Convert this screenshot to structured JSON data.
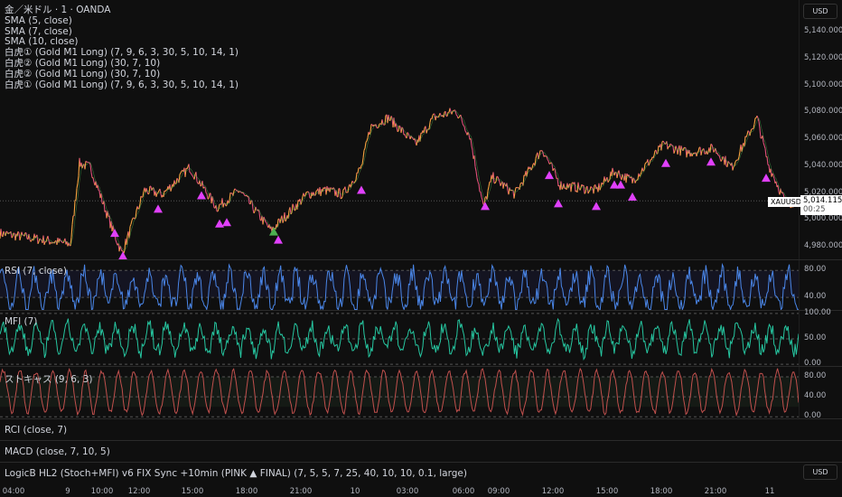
{
  "legend": {
    "title": "金／米ドル · 1 · OANDA",
    "lines": [
      "SMA (5, close)",
      "SMA (7, close)",
      "SMA (10, close)",
      "白虎① (Gold M1 Long) (7, 9, 6, 3, 30, 5, 10, 14, 1)",
      "白虎② (Gold M1 Long) (30, 7, 10)",
      "白虎② (Gold M1 Long) (30, 7, 10)",
      "白虎① (Gold M1 Long) (7, 9, 6, 3, 30, 5, 10, 14, 1)"
    ]
  },
  "currency": "USD",
  "price_axis": [
    "5,140.000",
    "5,120.000",
    "5,100.000",
    "5,080.000",
    "5,060.000",
    "5,040.000",
    "5,020.000",
    "5,000.000",
    "4,980.000"
  ],
  "price_values": [
    5140,
    5120,
    5100,
    5080,
    5060,
    5040,
    5020,
    5000,
    4980
  ],
  "symbol_flag": "XAUUSD",
  "last_price": "5,014.115",
  "countdown": "00:25",
  "colors": {
    "up": "#f7a440",
    "down": "#e0507a",
    "ma": "#4caf50",
    "marker": "#e040fb",
    "marker_alt": "#4caf50",
    "rsi": "#4a86e8",
    "mfi": "#26c6a0",
    "stoch": "#c0504d"
  },
  "price_anchors": [
    [
      0,
      4990
    ],
    [
      78,
      4982
    ],
    [
      88,
      5042
    ],
    [
      100,
      5039
    ],
    [
      125,
      4992
    ],
    [
      135,
      4975
    ],
    [
      160,
      5022
    ],
    [
      180,
      5019
    ],
    [
      210,
      5039
    ],
    [
      240,
      5009
    ],
    [
      265,
      5022
    ],
    [
      300,
      4992
    ],
    [
      340,
      5019
    ],
    [
      360,
      5022
    ],
    [
      380,
      5019
    ],
    [
      400,
      5039
    ],
    [
      410,
      5069
    ],
    [
      430,
      5076
    ],
    [
      460,
      5056
    ],
    [
      480,
      5076
    ],
    [
      505,
      5081
    ],
    [
      520,
      5063
    ],
    [
      535,
      5009
    ],
    [
      545,
      5032
    ],
    [
      570,
      5019
    ],
    [
      600,
      5053
    ],
    [
      620,
      5026
    ],
    [
      660,
      5022
    ],
    [
      680,
      5036
    ],
    [
      700,
      5029
    ],
    [
      735,
      5056
    ],
    [
      760,
      5050
    ],
    [
      790,
      5053
    ],
    [
      810,
      5039
    ],
    [
      838,
      5076
    ],
    [
      850,
      5042
    ],
    [
      870,
      5012
    ],
    [
      884,
      5014
    ]
  ],
  "markers": [
    [
      127,
      4990
    ],
    [
      136,
      4973
    ],
    [
      175,
      5008
    ],
    [
      223,
      5018
    ],
    [
      243,
      4997
    ],
    [
      251,
      4998
    ],
    [
      308,
      4985
    ],
    [
      400,
      5022
    ],
    [
      537,
      5010
    ],
    [
      608,
      5033
    ],
    [
      618,
      5012
    ],
    [
      660,
      5010
    ],
    [
      680,
      5026
    ],
    [
      687,
      5026
    ],
    [
      700,
      5017
    ],
    [
      737,
      5042
    ],
    [
      787,
      5043
    ],
    [
      848,
      5031
    ]
  ],
  "markers_alt": [
    [
      303,
      4991
    ]
  ],
  "panes": [
    {
      "label": "RSI (7, close)",
      "ticks": [
        "80.00",
        "40.00"
      ],
      "tick_values": [
        80,
        40
      ],
      "range": [
        20,
        95
      ]
    },
    {
      "label": "MFI (7)",
      "ticks": [
        "100.00",
        "50.00",
        "0.00"
      ],
      "tick_values": [
        100,
        50,
        0
      ],
      "range": [
        -5,
        105
      ]
    },
    {
      "label": "ストキャス (9, 6, 3)",
      "ticks": [
        "80.00",
        "40.00",
        "0.00"
      ],
      "tick_values": [
        80,
        40,
        0
      ],
      "range": [
        -5,
        100
      ]
    },
    {
      "label": "RCI (close, 7)"
    },
    {
      "label": "MACD (close, 7, 10, 5)"
    },
    {
      "label": "LogicB HL2 (Stoch+MFI) v6 FIX Sync +10min (PINK ▲ FINAL) (7, 5, 5, 7, 25, 40, 10, 10, 0.1, large)"
    }
  ],
  "time_axis": [
    "04:00",
    "9",
    "10:00",
    "12:00",
    "15:00",
    "18:00",
    "21:00",
    "10",
    "03:00",
    "06:00",
    "09:00",
    "12:00",
    "15:00",
    "18:00",
    "21:00",
    "11"
  ]
}
